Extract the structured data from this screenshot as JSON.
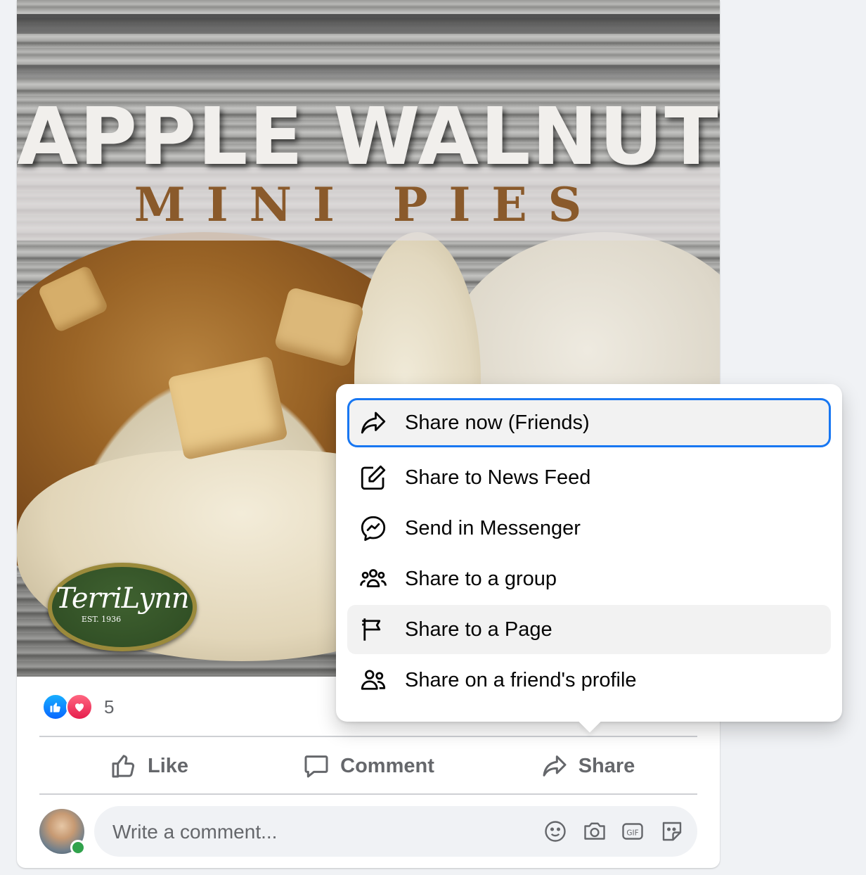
{
  "image": {
    "title_main": "APPLE WALNUT",
    "title_sub": "MINI PIES",
    "logo_name": "TerriLynn",
    "logo_est": "EST. 1936"
  },
  "reactions": {
    "count": "5",
    "like_color": "#0866ff",
    "love_color": "#e61e4d"
  },
  "actions": {
    "like": "Like",
    "comment": "Comment",
    "share": "Share"
  },
  "comment": {
    "placeholder": "Write a comment...",
    "icons": [
      "emoji-icon",
      "camera-icon",
      "gif-icon",
      "sticker-icon"
    ]
  },
  "share_menu": {
    "items": [
      {
        "label": "Share now (Friends)",
        "icon": "share-arrow-icon",
        "state": "focused"
      },
      {
        "label": "Share to News Feed",
        "icon": "edit-icon",
        "state": "normal"
      },
      {
        "label": "Send in Messenger",
        "icon": "messenger-icon",
        "state": "normal"
      },
      {
        "label": "Share to a group",
        "icon": "group-icon",
        "state": "normal"
      },
      {
        "label": "Share to a Page",
        "icon": "flag-icon",
        "state": "hover"
      },
      {
        "label": "Share on a friend's profile",
        "icon": "friends-icon",
        "state": "normal"
      }
    ],
    "focus_color": "#1877f2"
  }
}
